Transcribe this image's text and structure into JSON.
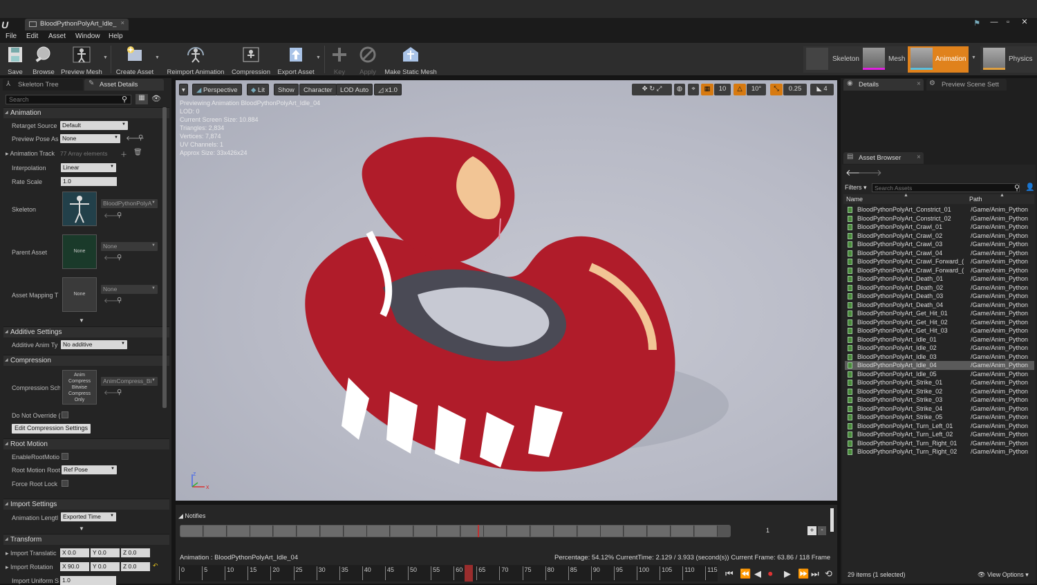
{
  "window": {
    "tab_title": "BloodPythonPolyArt_Idle_",
    "controls": [
      "—",
      "▫",
      "✕"
    ]
  },
  "menu": [
    "File",
    "Edit",
    "Asset",
    "Window",
    "Help"
  ],
  "toolbar": {
    "save": "Save",
    "browse": "Browse",
    "preview_mesh": "Preview Mesh",
    "create_asset": "Create Asset",
    "reimport": "Reimport Animation",
    "compression": "Compression",
    "export": "Export Asset",
    "key": "Key",
    "apply": "Apply",
    "make_static": "Make Static Mesh"
  },
  "modes": {
    "skeleton": "Skeleton",
    "mesh": "Mesh",
    "animation": "Animation",
    "physics": "Physics"
  },
  "left_panel": {
    "tabs": [
      "Skeleton Tree",
      "Asset Details"
    ],
    "search_placeholder": "Search",
    "animation": {
      "header": "Animation",
      "retarget_label": "Retarget Source",
      "retarget_value": "Default",
      "preview_pose_label": "Preview Pose As",
      "preview_pose_value": "None",
      "track_label": "Animation Track",
      "track_value": "77 Array elements",
      "interp_label": "Interpolation",
      "interp_value": "Linear",
      "rate_label": "Rate Scale",
      "rate_value": "1.0",
      "skeleton_label": "Skeleton",
      "skeleton_value": "BloodPythonPolyA",
      "parent_label": "Parent Asset",
      "parent_thumb": "None",
      "parent_value": "None",
      "mapping_label": "Asset Mapping T",
      "mapping_thumb": "None",
      "mapping_value": "None"
    },
    "additive": {
      "header": "Additive Settings",
      "label": "Additive Anim Ty",
      "value": "No additive"
    },
    "compression": {
      "header": "Compression",
      "label": "Compression Sch",
      "thumb": "Anim Compress Bitwise Compress Only",
      "value": "AnimCompress_Bi",
      "override_label": "Do Not Override (",
      "button": "Edit Compression Settings"
    },
    "root_motion": {
      "header": "Root Motion",
      "enable_label": "EnableRootMotio",
      "root_label": "Root Motion Root",
      "root_value": "Ref Pose",
      "force_label": "Force Root Lock"
    },
    "import": {
      "header": "Import Settings",
      "length_label": "Animation Lengtl",
      "length_value": "Exported Time"
    },
    "transform": {
      "header": "Transform",
      "trans_label": "Import Translatic",
      "trans_x": "X 0.0",
      "trans_y": "Y 0.0",
      "trans_z": "Z 0.0",
      "rot_label": "Import Rotation",
      "rot_x": "X 90.0",
      "rot_y": "Y 0.0",
      "rot_z": "Z 0.0",
      "scale_label": "Import Uniform S",
      "scale_value": "1.0"
    }
  },
  "viewport": {
    "perspective": "Perspective",
    "lit": "Lit",
    "show": "Show",
    "character": "Character",
    "lod": "LOD Auto",
    "speed": "x1.0",
    "grid_snap": "10",
    "rot_snap": "10°",
    "scale_snap": "0.25",
    "cam_speed": "4",
    "info": [
      "Previewing Animation BloodPythonPolyArt_Idle_04",
      "LOD: 0",
      "Current Screen Size: 10.884",
      "Triangles: 2,834",
      "Vertices: 7,874",
      "UV Channels: 1",
      "Approx Size: 33x426x24"
    ]
  },
  "timeline": {
    "notifies": "Notifies",
    "track_num": "1",
    "anim_label": "Animation :  BloodPythonPolyArt_Idle_04",
    "status": "Percentage:  54.12% CurrentTime:  2.129 / 3.933 (second(s)) Current Frame:  63.86 / 118 Frame",
    "ticks": [
      "0",
      "5",
      "10",
      "15",
      "20",
      "25",
      "30",
      "35",
      "40",
      "45",
      "50",
      "55",
      "60",
      "65",
      "70",
      "75",
      "80",
      "85",
      "90",
      "95",
      "100",
      "105",
      "110",
      "115"
    ]
  },
  "right_panel": {
    "tabs": [
      "Details",
      "Preview Scene Sett"
    ],
    "browser_tab": "Asset Browser",
    "filters": "Filters ▾",
    "search_placeholder": "Search Assets",
    "col_name": "Name",
    "col_path": "Path",
    "assets": [
      [
        "BloodPythonPolyArt_Constrict_01",
        "/Game/Anim_Python"
      ],
      [
        "BloodPythonPolyArt_Constrict_02",
        "/Game/Anim_Python"
      ],
      [
        "BloodPythonPolyArt_Crawl_01",
        "/Game/Anim_Python"
      ],
      [
        "BloodPythonPolyArt_Crawl_02",
        "/Game/Anim_Python"
      ],
      [
        "BloodPythonPolyArt_Crawl_03",
        "/Game/Anim_Python"
      ],
      [
        "BloodPythonPolyArt_Crawl_04",
        "/Game/Anim_Python"
      ],
      [
        "BloodPythonPolyArt_Crawl_Forward_(",
        "/Game/Anim_Python"
      ],
      [
        "BloodPythonPolyArt_Crawl_Forward_(",
        "/Game/Anim_Python"
      ],
      [
        "BloodPythonPolyArt_Death_01",
        "/Game/Anim_Python"
      ],
      [
        "BloodPythonPolyArt_Death_02",
        "/Game/Anim_Python"
      ],
      [
        "BloodPythonPolyArt_Death_03",
        "/Game/Anim_Python"
      ],
      [
        "BloodPythonPolyArt_Death_04",
        "/Game/Anim_Python"
      ],
      [
        "BloodPythonPolyArt_Get_Hit_01",
        "/Game/Anim_Python"
      ],
      [
        "BloodPythonPolyArt_Get_Hit_02",
        "/Game/Anim_Python"
      ],
      [
        "BloodPythonPolyArt_Get_Hit_03",
        "/Game/Anim_Python"
      ],
      [
        "BloodPythonPolyArt_Idle_01",
        "/Game/Anim_Python"
      ],
      [
        "BloodPythonPolyArt_Idle_02",
        "/Game/Anim_Python"
      ],
      [
        "BloodPythonPolyArt_Idle_03",
        "/Game/Anim_Python"
      ],
      [
        "BloodPythonPolyArt_Idle_04",
        "/Game/Anim_Python"
      ],
      [
        "BloodPythonPolyArt_Idle_05",
        "/Game/Anim_Python"
      ],
      [
        "BloodPythonPolyArt_Strike_01",
        "/Game/Anim_Python"
      ],
      [
        "BloodPythonPolyArt_Strike_02",
        "/Game/Anim_Python"
      ],
      [
        "BloodPythonPolyArt_Strike_03",
        "/Game/Anim_Python"
      ],
      [
        "BloodPythonPolyArt_Strike_04",
        "/Game/Anim_Python"
      ],
      [
        "BloodPythonPolyArt_Strike_05",
        "/Game/Anim_Python"
      ],
      [
        "BloodPythonPolyArt_Turn_Left_01",
        "/Game/Anim_Python"
      ],
      [
        "BloodPythonPolyArt_Turn_Left_02",
        "/Game/Anim_Python"
      ],
      [
        "BloodPythonPolyArt_Turn_Right_01",
        "/Game/Anim_Python"
      ],
      [
        "BloodPythonPolyArt_Turn_Right_02",
        "/Game/Anim_Python"
      ]
    ],
    "selected_index": 18,
    "count": "29 items (1 selected)",
    "view_options": "View Options ▾"
  }
}
